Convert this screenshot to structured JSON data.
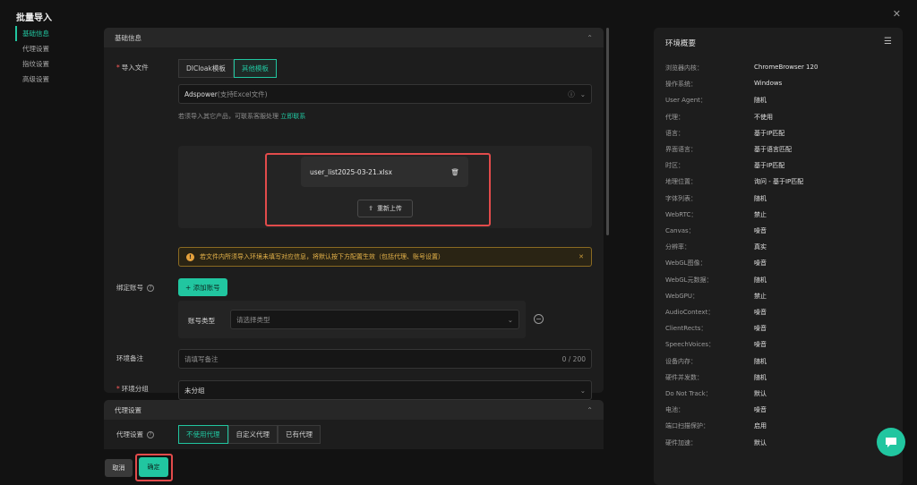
{
  "dialog": {
    "title": "批量导入"
  },
  "nav": {
    "items": [
      "基础信息",
      "代理设置",
      "指纹设置",
      "高级设置"
    ]
  },
  "basic": {
    "section_title": "基础信息",
    "import_label": "导入文件",
    "tabs": [
      "DICloak模板",
      "其他模板"
    ],
    "source_value": "Adspower",
    "source_hint": "(支持Excel文件)",
    "contact_text": "若须导入其它产品，可联系客服处理",
    "contact_link": "立即联系",
    "file_name": "user_list2025-03-21.xlsx",
    "reupload_label": "重新上传",
    "warning_text": "若文件内所须导入环境未填写对应信息，将默认按下方配置生效（包括代理、账号设置）",
    "bind_label": "绑定账号",
    "add_account_label": "+ 添加账号",
    "acct_type_label": "账号类型",
    "acct_type_placeholder": "请选择类型",
    "note_label": "环境备注",
    "note_placeholder": "请填写备注",
    "note_counter": "0 / 200",
    "group_label": "环境分组",
    "group_value": "未分组"
  },
  "proxy": {
    "section_title": "代理设置",
    "label": "代理设置",
    "tabs": [
      "不使用代理",
      "自定义代理",
      "已有代理"
    ]
  },
  "footer": {
    "cancel": "取消",
    "ok": "确定"
  },
  "summary": {
    "title": "环境概要",
    "rows": [
      [
        "浏览器内核：",
        "ChromeBrowser 120"
      ],
      [
        "操作系统：",
        "Windows"
      ],
      [
        "User Agent：",
        "随机"
      ],
      [
        "代理：",
        "不使用"
      ],
      [
        "语言：",
        "基于IP匹配"
      ],
      [
        "界面语言：",
        "基于语言匹配"
      ],
      [
        "时区：",
        "基于IP匹配"
      ],
      [
        "地理位置：",
        "询问 - 基于IP匹配"
      ],
      [
        "字体列表：",
        "随机"
      ],
      [
        "WebRTC：",
        "禁止"
      ],
      [
        "Canvas：",
        "噪音"
      ],
      [
        "分辨率：",
        "真实"
      ],
      [
        "WebGL图像：",
        "噪音"
      ],
      [
        "WebGL元数据：",
        "随机"
      ],
      [
        "WebGPU：",
        "禁止"
      ],
      [
        "AudioContext：",
        "噪音"
      ],
      [
        "ClientRects：",
        "噪音"
      ],
      [
        "SpeechVoices：",
        "噪音"
      ],
      [
        "设备内存：",
        "随机"
      ],
      [
        "硬件并发数：",
        "随机"
      ],
      [
        "Do Not Track：",
        "默认"
      ],
      [
        "电池：",
        "噪音"
      ],
      [
        "端口扫描保护：",
        "启用"
      ],
      [
        "硬件加速：",
        "默认"
      ]
    ]
  }
}
